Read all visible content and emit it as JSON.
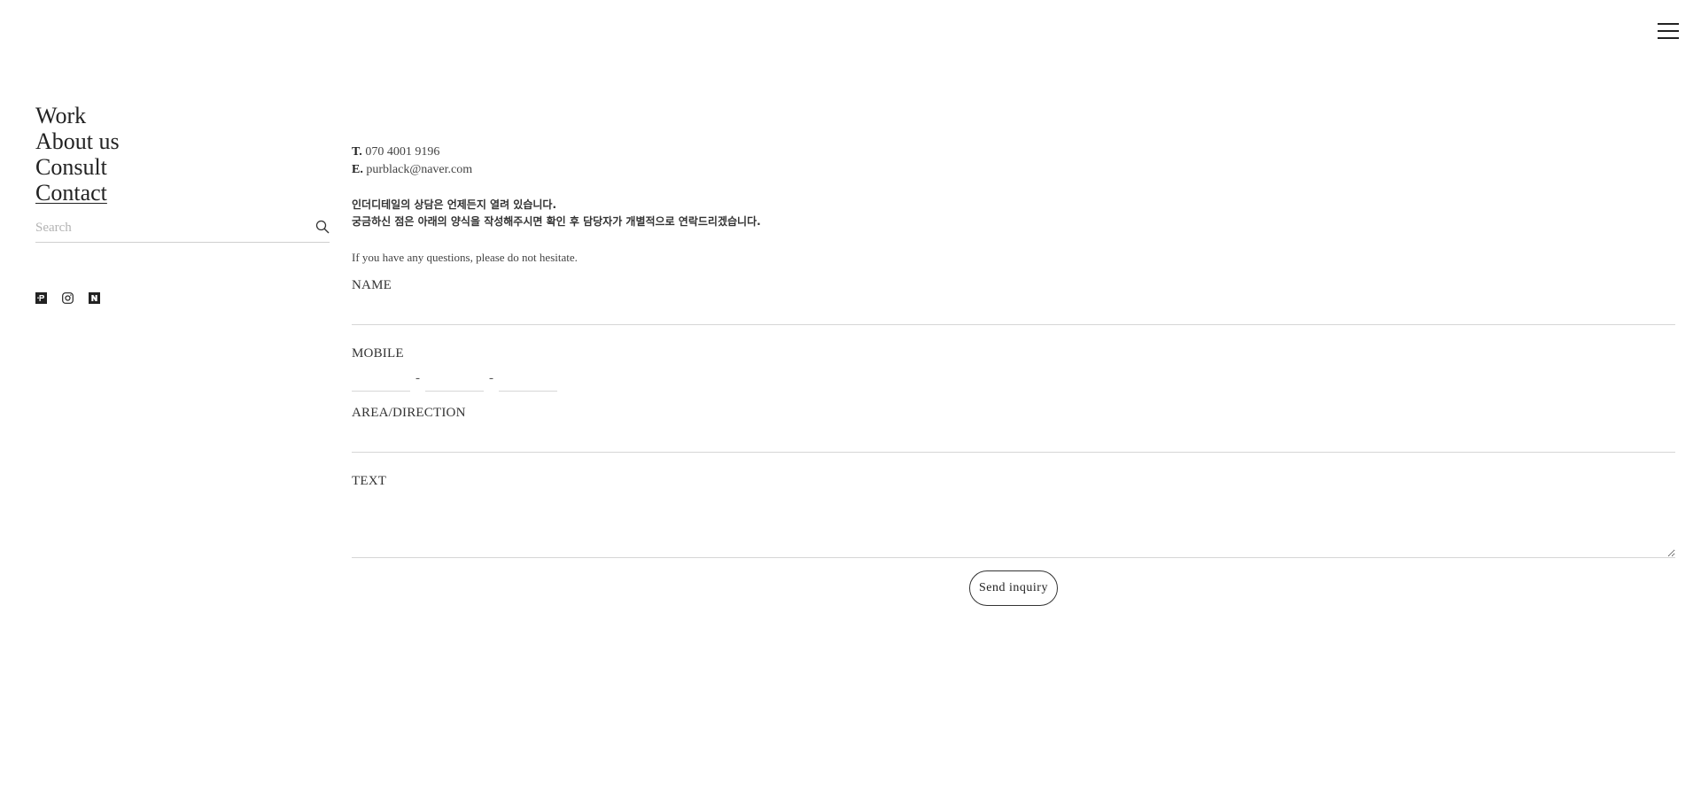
{
  "nav": {
    "items": [
      {
        "label": "Work",
        "active": false
      },
      {
        "label": "About us",
        "active": false
      },
      {
        "label": "Consult",
        "active": false
      },
      {
        "label": "Contact",
        "active": true
      }
    ]
  },
  "search": {
    "placeholder": "Search",
    "icon": "search-icon"
  },
  "social": {
    "icons": [
      "post-icon",
      "instagram-icon",
      "naver-icon"
    ]
  },
  "contact": {
    "phone_prefix": "T.",
    "phone": "070 4001 9196",
    "email_prefix": "E.",
    "email": "purblack@naver.com"
  },
  "notice": {
    "line1": "인더디테일의 상담은 언제든지 열려 있습니다.",
    "line2": "궁금하신 점은 아래의 양식을 작성해주시면 확인 후 담당자가 개별적으로 연락드리겠습니다.",
    "english": "If you have any questions, please do not hesitate."
  },
  "form": {
    "name_label": "NAME",
    "mobile_label": "MOBILE",
    "mobile_separator": "-",
    "area_label": "AREA/DIRECTION",
    "text_label": "TEXT",
    "submit_label": "Send inquiry"
  },
  "colors": {
    "text": "#222222",
    "border": "#d6d6d6",
    "background": "#ffffff"
  }
}
